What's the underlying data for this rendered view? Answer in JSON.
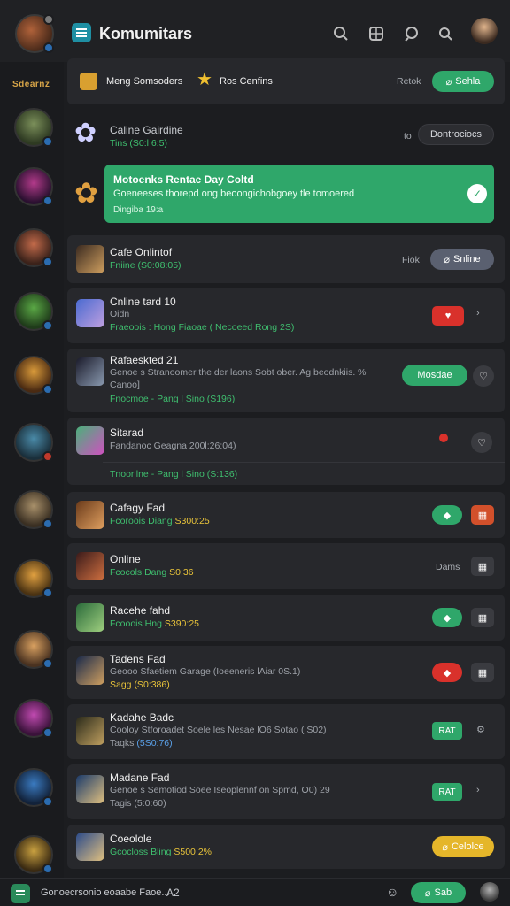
{
  "header": {
    "title": "Komumitars",
    "icons": [
      "search-icon",
      "dashboard-icon",
      "discover-icon",
      "settings-icon"
    ]
  },
  "rail": {
    "logo": "Sdearnz"
  },
  "featured": {
    "item1": "Meng Somsoders",
    "item2": "Ros Cenfins",
    "label": "Retok",
    "button": "Sehla"
  },
  "online_game": {
    "name": "Caline Gairdine",
    "sub": "Tins (S0:l 6:5)",
    "dot": "to",
    "button": "Dontrociocs"
  },
  "promo": {
    "title": "Motoenks Rentae Day Coltd",
    "text": "Goeneeses thorepd ong beoongichobgoey tle tomoered",
    "sub": "Dingiba 19:a"
  },
  "rows": [
    {
      "name": "Cafe Onlintof",
      "sub": "Fniine (S0:08:05)",
      "label": "Fiok",
      "button": "Snline"
    },
    {
      "name": "Cnline tard 10",
      "sub1": "Oidn",
      "sub2": "Fraeoois : Hong Fiaoae ( Necoeed Rong 2S)"
    },
    {
      "name": "Rafaeskted 21",
      "sub1": "Genoe s Stranoomer the der laons Sobt ober. Ag beodnkiis. %",
      "sub1b": "Canoo]",
      "sub2": "Fnocmoe - Pang l Sino (S196)",
      "button": "Mosdae"
    },
    {
      "name": "Sitarad",
      "sub1": "Fandanoc Geagna 200l:26:04)",
      "sub2": "Tnoorilne - Pang l Sino (S:136)"
    },
    {
      "name": "Cafagy Fad",
      "sub": "Fcoroois Diang",
      "price": "S300:25"
    },
    {
      "name": "Online",
      "sub": "Fcocols Dang",
      "price": "S0:36",
      "label": "Dams"
    },
    {
      "name": "Racehe fahd",
      "sub": "Fcooois Hng",
      "price": "S390:25"
    },
    {
      "name": "Tadens Fad",
      "sub1": "Geooo Sfaetiem Garage (Ioeeneris lAiar 0S.1)",
      "sub2": "Sagg (S0:386)"
    },
    {
      "name": "Kadahe Badc",
      "sub1": "Cooloy Stforoadet Soele les Nesae lO6 Sotao ( S02)",
      "sub2": "Taqks",
      "sub2b": "(5S0:76)",
      "button": "RAT"
    },
    {
      "name": "Madane Fad",
      "sub1": "Genoe s Semotiod Soee Iseoplennf on Spmd, O0) 29",
      "sub2": "Tagis (5:0:60)",
      "button": "RAT"
    },
    {
      "name": "Coeolole",
      "sub": "Gcocloss Bling",
      "price": "S500 2%",
      "button": "Celolce"
    }
  ],
  "footer": {
    "text": "Gonoecrsonio eoaabe Faoe...",
    "count": "A2",
    "button": "Sab"
  },
  "colors": {
    "accent_green": "#2fa76a",
    "red": "#d9312b",
    "orange": "#d2502b",
    "yellow": "#e5b62a",
    "card": "#27282c",
    "bg": "#1c1d20"
  }
}
